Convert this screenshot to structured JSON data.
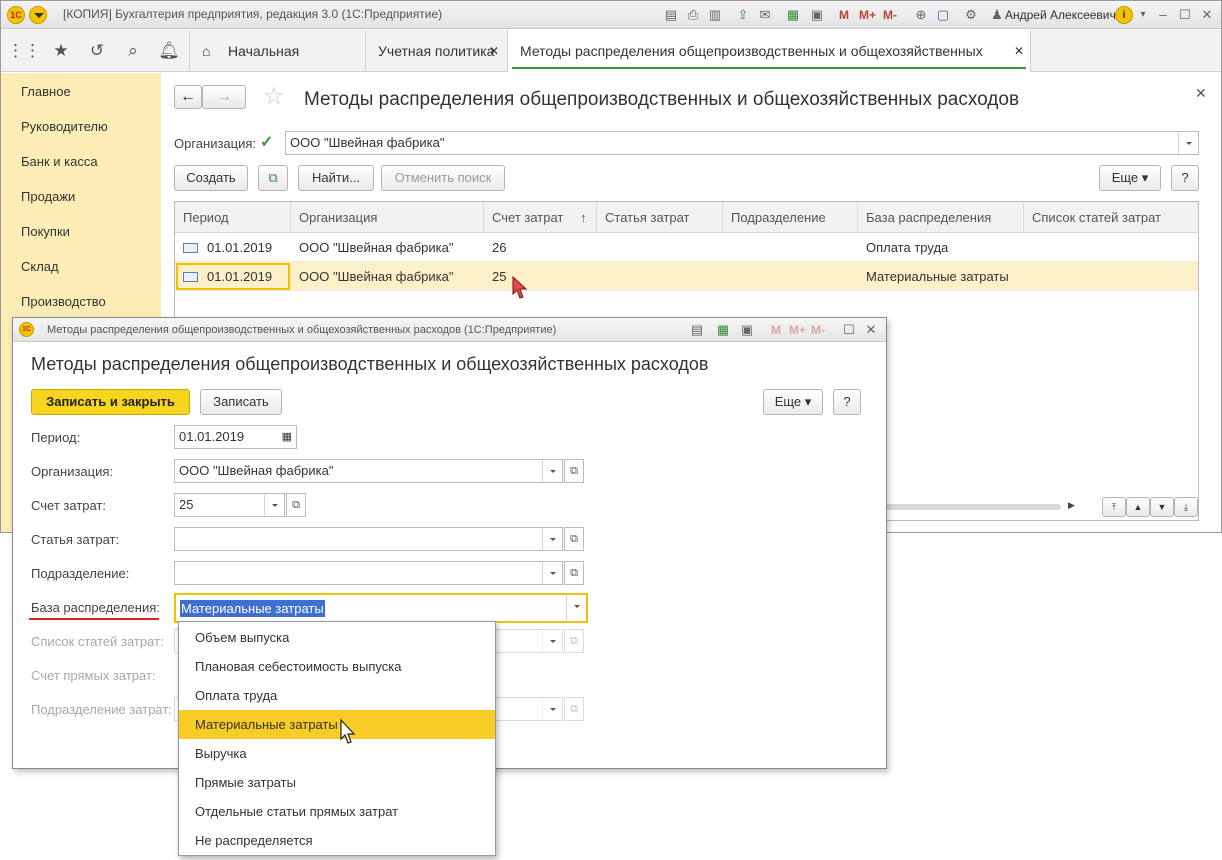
{
  "window": {
    "title": "[КОПИЯ] Бухгалтерия предприятия, редакция 3.0  (1С:Предприятие)",
    "user": "Андрей Алексеевич",
    "m_labels": [
      "M",
      "M+",
      "M-"
    ]
  },
  "tabs": [
    {
      "label": "Начальная страница"
    },
    {
      "label": "Учетная политика"
    },
    {
      "label": "Методы распределения общепроизводственных и общехозяйственных расходов"
    }
  ],
  "sidebar": {
    "items": [
      {
        "label": "Главное"
      },
      {
        "label": "Руководителю"
      },
      {
        "label": "Банк и касса"
      },
      {
        "label": "Продажи"
      },
      {
        "label": "Покупки"
      },
      {
        "label": "Склад"
      },
      {
        "label": "Производство"
      }
    ]
  },
  "list": {
    "title": "Методы распределения общепроизводственных и общехозяйственных расходов",
    "org_label": "Организация:",
    "org_value": "ООО \"Швейная фабрика\"",
    "buttons": {
      "create": "Создать",
      "find": "Найти...",
      "cancel_search": "Отменить поиск",
      "more": "Еще",
      "help": "?"
    },
    "columns": [
      "Период",
      "Организация",
      "Счет затрат",
      "Статья затрат",
      "Подразделение",
      "База распределения",
      "Список статей затрат"
    ],
    "rows": [
      {
        "period": "01.01.2019",
        "org": "ООО \"Швейная фабрика\"",
        "account": "26",
        "item": "",
        "dept": "",
        "base": "Оплата труда",
        "items_list": ""
      },
      {
        "period": "01.01.2019",
        "org": "ООО \"Швейная фабрика\"",
        "account": "25",
        "item": "",
        "dept": "",
        "base": "Материальные затраты",
        "items_list": ""
      }
    ]
  },
  "dialog": {
    "window_title": "Методы распределения общепроизводственных и общехозяйственных расходов  (1С:Предприятие)",
    "heading": "Методы распределения общепроизводственных и общехозяйственных расходов",
    "buttons": {
      "save_close": "Записать и закрыть",
      "save": "Записать",
      "more": "Еще",
      "help": "?"
    },
    "fields": {
      "period": {
        "label": "Период:",
        "value": "01.01.2019"
      },
      "org": {
        "label": "Организация:",
        "value": "ООО \"Швейная фабрика\""
      },
      "account": {
        "label": "Счет затрат:",
        "value": "25"
      },
      "item": {
        "label": "Статья затрат:",
        "value": ""
      },
      "dept": {
        "label": "Подразделение:",
        "value": ""
      },
      "base": {
        "label": "База распределения:",
        "value": "Материальные затраты"
      },
      "items_list": {
        "label": "Список статей затрат:",
        "value": ""
      },
      "direct_account": {
        "label": "Счет прямых затрат:",
        "value": ""
      },
      "cost_dept": {
        "label": "Подразделение затрат:",
        "value": ""
      }
    }
  },
  "dropdown": {
    "options": [
      "Объем выпуска",
      "Плановая себестоимость выпуска",
      "Оплата труда",
      "Материальные затраты",
      "Выручка",
      "Прямые затраты",
      "Отдельные статьи прямых затрат",
      "Не распределяется"
    ],
    "selected": "Материальные затраты"
  },
  "colors": {
    "sidebar": "#fbedb5",
    "selected_row": "#fbf0c7",
    "accent_yellow": "#f7cc26",
    "active_tab_underline": "#3a9a3a"
  }
}
